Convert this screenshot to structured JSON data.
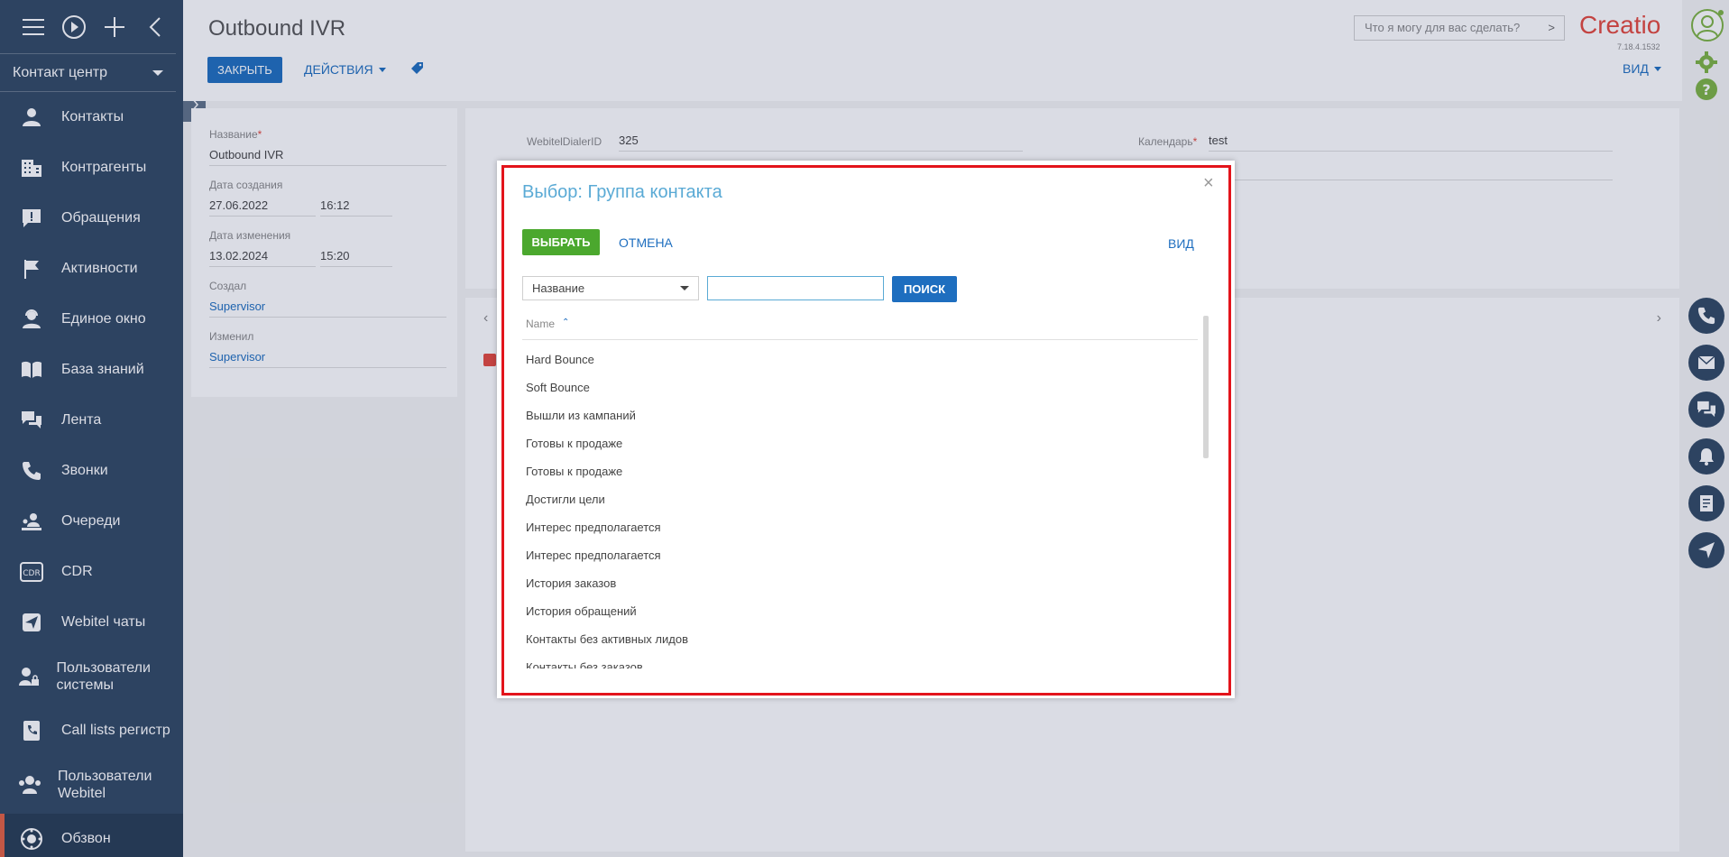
{
  "sidebar": {
    "workspace": "Контакт центр",
    "items": [
      {
        "label": "Контакты",
        "icon": "user-icon"
      },
      {
        "label": "Контрагенты",
        "icon": "building-icon"
      },
      {
        "label": "Обращения",
        "icon": "alert-icon"
      },
      {
        "label": "Активности",
        "icon": "flag-icon"
      },
      {
        "label": "Единое окно",
        "icon": "user-headset-icon"
      },
      {
        "label": "База знаний",
        "icon": "book-icon"
      },
      {
        "label": "Лента",
        "icon": "chat-icon"
      },
      {
        "label": "Звонки",
        "icon": "phone-icon"
      },
      {
        "label": "Очереди",
        "icon": "queue-icon"
      },
      {
        "label": "CDR",
        "icon": "cdr-icon"
      },
      {
        "label": "Webitel чаты",
        "icon": "send-icon"
      },
      {
        "label": "Пользователи системы",
        "icon": "user-lock-icon"
      },
      {
        "label": "Call lists регистр",
        "icon": "phone-book-icon"
      },
      {
        "label": "Пользователи Webitel",
        "icon": "users-icon"
      },
      {
        "label": "Обзвон",
        "icon": "dial-icon"
      }
    ]
  },
  "header": {
    "title": "Outbound IVR",
    "close_label": "ЗАКРЫТЬ",
    "actions_label": "ДЕЙСТВИЯ",
    "command_placeholder": "Что я могу для вас сделать?",
    "logo": "Creatio",
    "version": "7.18.4.1532",
    "view_label": "ВИД"
  },
  "left_panel": {
    "name_label": "Название",
    "name_value": "Outbound IVR",
    "created_label": "Дата создания",
    "created_date": "27.06.2022",
    "created_time": "16:12",
    "modified_label": "Дата изменения",
    "modified_date": "13.02.2024",
    "modified_time": "15:20",
    "created_by_label": "Создал",
    "created_by": "Supervisor",
    "modified_by_label": "Изменил",
    "modified_by": "Supervisor"
  },
  "main_panel": {
    "dialer_label": "WebitelDialerID",
    "dialer_value": "325",
    "calendar_label": "Календарь",
    "calendar_value": "test"
  },
  "modal": {
    "title": "Выбор: Группа контакта",
    "select_label": "ВЫБРАТЬ",
    "cancel_label": "ОТМЕНА",
    "view_label": "ВИД",
    "filter_field": "Название",
    "search_value": "",
    "search_label": "ПОИСК",
    "column_header": "Name",
    "rows": [
      "Hard Bounce",
      "Soft Bounce",
      "Вышли из кампаний",
      "Готовы к продаже",
      "Готовы к продаже",
      "Достигли цели",
      "Интерес предполагается",
      "Интерес предполагается",
      "История заказов",
      "История обращений",
      "Контакты без активных лидов",
      "Контакты без заказов"
    ]
  },
  "colors": {
    "sidebar_bg": "#2f4762",
    "primary": "#1e6ebf",
    "success": "#4ba82e",
    "highlight_frame": "#e3141b",
    "active_marker": "#e46040"
  }
}
